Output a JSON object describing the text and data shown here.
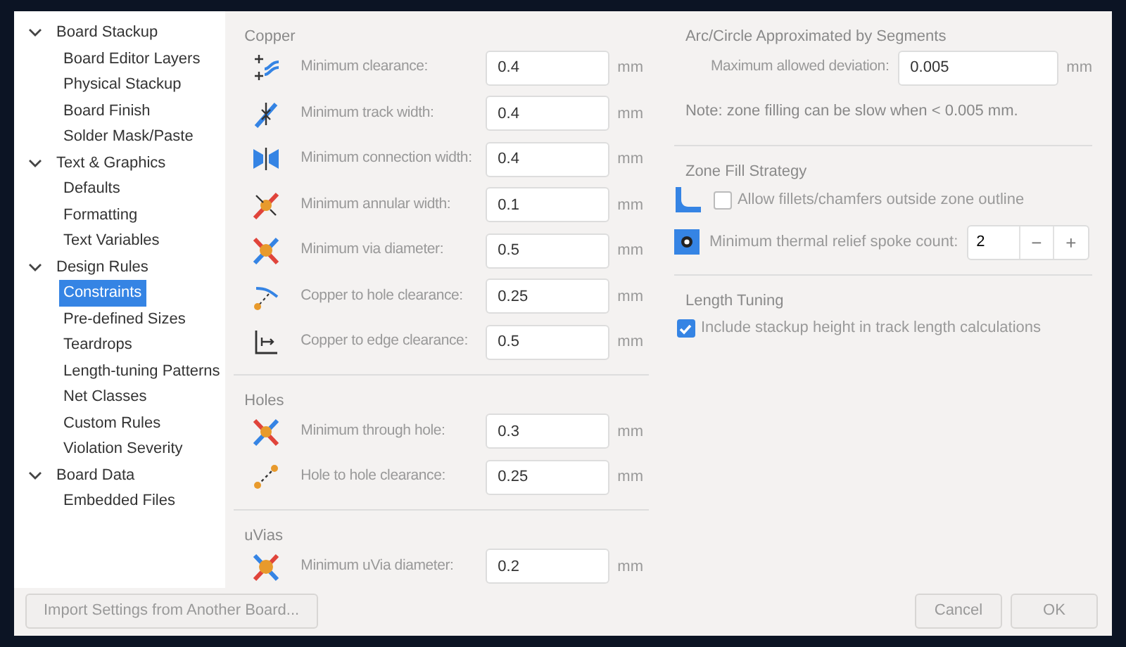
{
  "sidebar": {
    "groups": [
      {
        "label": "Board Stackup",
        "expanded": true,
        "children": [
          {
            "label": "Board Editor Layers",
            "selected": false
          },
          {
            "label": "Physical Stackup",
            "selected": false
          },
          {
            "label": "Board Finish",
            "selected": false
          },
          {
            "label": "Solder Mask/Paste",
            "selected": false
          }
        ]
      },
      {
        "label": "Text & Graphics",
        "expanded": true,
        "children": [
          {
            "label": "Defaults",
            "selected": false
          },
          {
            "label": "Formatting",
            "selected": false
          },
          {
            "label": "Text Variables",
            "selected": false
          }
        ]
      },
      {
        "label": "Design Rules",
        "expanded": true,
        "children": [
          {
            "label": "Constraints",
            "selected": true
          },
          {
            "label": "Pre-defined Sizes",
            "selected": false
          },
          {
            "label": "Teardrops",
            "selected": false
          },
          {
            "label": "Length-tuning Patterns",
            "selected": false
          },
          {
            "label": "Net Classes",
            "selected": false
          },
          {
            "label": "Custom Rules",
            "selected": false
          },
          {
            "label": "Violation Severity",
            "selected": false
          }
        ]
      },
      {
        "label": "Board Data",
        "expanded": true,
        "children": [
          {
            "label": "Embedded Files",
            "selected": false
          }
        ]
      }
    ]
  },
  "left_sections": [
    {
      "title": "Copper",
      "rows": [
        {
          "label": "Minimum clearance:",
          "value": "0.4",
          "unit": "mm"
        },
        {
          "label": "Minimum track width:",
          "value": "0.4",
          "unit": "mm"
        },
        {
          "label": "Minimum connection width:",
          "value": "0.4",
          "unit": "mm"
        },
        {
          "label": "Minimum annular width:",
          "value": "0.1",
          "unit": "mm"
        },
        {
          "label": "Minimum via diameter:",
          "value": "0.5",
          "unit": "mm"
        },
        {
          "label": "Copper to hole clearance:",
          "value": "0.25",
          "unit": "mm"
        },
        {
          "label": "Copper to edge clearance:",
          "value": "0.5",
          "unit": "mm"
        }
      ]
    },
    {
      "title": "Holes",
      "rows": [
        {
          "label": "Minimum through hole:",
          "value": "0.3",
          "unit": "mm"
        },
        {
          "label": "Hole to hole clearance:",
          "value": "0.25",
          "unit": "mm"
        }
      ]
    },
    {
      "title": "uVias",
      "rows": [
        {
          "label": "Minimum uVia diameter:",
          "value": "0.2",
          "unit": "mm"
        }
      ]
    }
  ],
  "arc_section": {
    "title": "Arc/Circle Approximated by Segments",
    "label": "Maximum allowed deviation:",
    "value": "0.005",
    "unit": "mm",
    "note": "Note: zone filling can be slow when < 0.005 mm."
  },
  "zone_fill": {
    "title": "Zone Fill Strategy",
    "checkbox": {
      "label": "Allow fillets/chamfers outside zone outline",
      "checked": false
    },
    "spoke": {
      "label": "Minimum thermal relief spoke count:",
      "value": "2",
      "minus": "−",
      "plus": "+"
    }
  },
  "length_tuning": {
    "title": "Length Tuning",
    "checkbox": {
      "label": "Include stackup height in track length calculations",
      "checked": true
    }
  },
  "buttons": {
    "import": "Import Settings from Another Board...",
    "cancel": "Cancel",
    "ok": "OK"
  }
}
